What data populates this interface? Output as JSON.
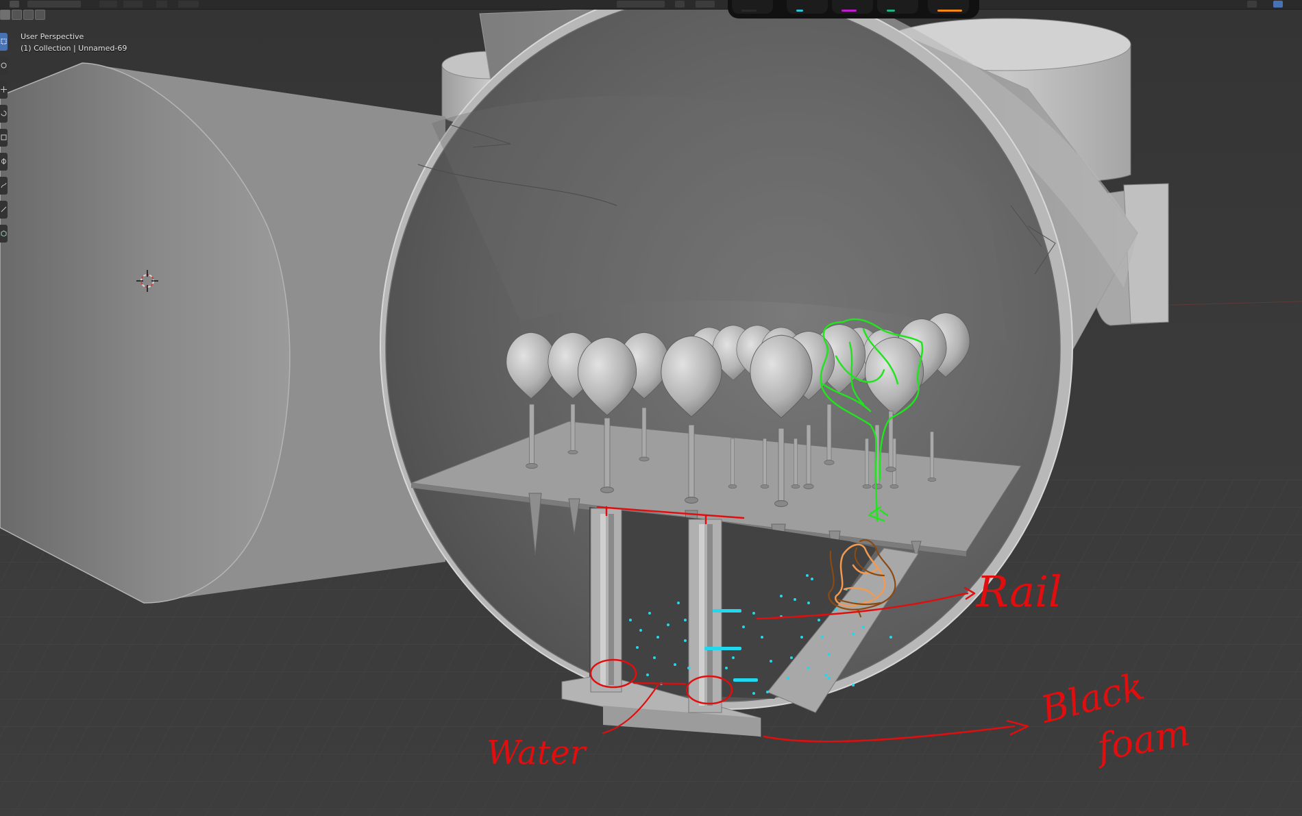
{
  "viewport": {
    "perspective_label": "User Perspective",
    "collection_label": "(1) Collection | Unnamed-69"
  },
  "annotations": {
    "rail_label": "Rail",
    "water_label": "Water",
    "black_foam_label_line1": "Black",
    "black_foam_label_line2": "foam"
  },
  "icons": {
    "cursor": "3d-cursor-icon",
    "select": "select-box-icon",
    "cursor_tool": "cursor-tool-icon",
    "move": "move-icon",
    "rotate": "rotate-icon",
    "scale": "scale-icon",
    "transform": "transform-icon",
    "annotate": "annotate-icon",
    "measure": "measure-icon",
    "add_cube": "add-cube-icon"
  },
  "colors": {
    "accent": "#4772b3",
    "annotation_red": "#e00e0e",
    "annotation_green": "#22e31f",
    "annotation_orange": "#f29a52",
    "annotation_brown": "#8a4a12",
    "water_cyan": "#22d8ee"
  }
}
